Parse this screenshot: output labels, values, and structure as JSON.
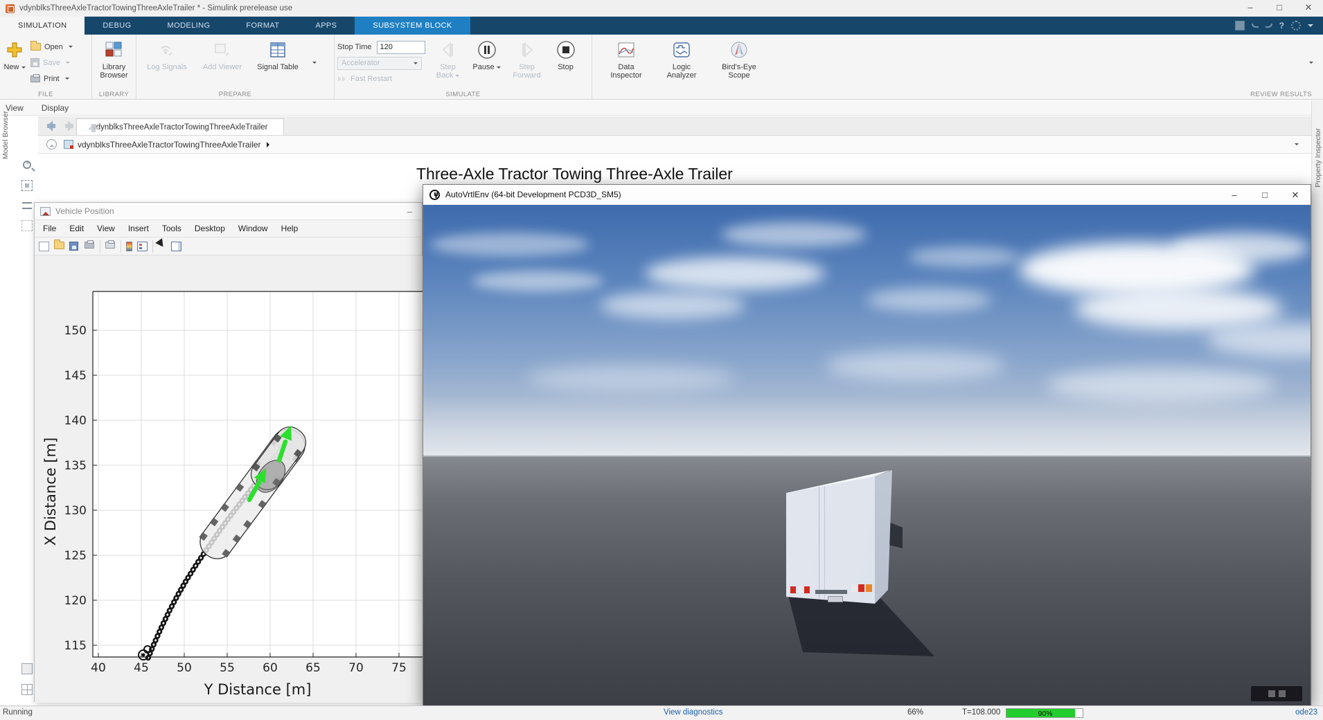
{
  "window": {
    "title": "vdynblksThreeAxleTractorTowingThreeAxleTrailer * - Simulink prerelease use"
  },
  "ribbon_tabs": [
    {
      "label": "SIMULATION",
      "state": "active"
    },
    {
      "label": "DEBUG",
      "state": "normal"
    },
    {
      "label": "MODELING",
      "state": "normal"
    },
    {
      "label": "FORMAT",
      "state": "normal"
    },
    {
      "label": "APPS",
      "state": "normal"
    },
    {
      "label": "SUBSYSTEM BLOCK",
      "state": "context"
    }
  ],
  "ribbon": {
    "sections": [
      "FILE",
      "LIBRARY",
      "PREPARE",
      "SIMULATE",
      "REVIEW RESULTS"
    ],
    "file": {
      "new": "New",
      "open": "Open",
      "save": "Save",
      "print": "Print"
    },
    "library": {
      "browser": "Library Browser"
    },
    "prepare": {
      "log_signals": "Log Signals",
      "add_viewer": "Add Viewer",
      "signal_table": "Signal Table"
    },
    "simulate": {
      "stop_time_label": "Stop Time",
      "stop_time_value": "120",
      "accelerator": "Accelerator",
      "fast_restart": "Fast Restart",
      "step_back": "Step Back",
      "pause": "Pause",
      "step_forward": "Step Forward",
      "stop": "Stop"
    },
    "review": {
      "data_inspector": "Data Inspector",
      "logic_analyzer": "Logic Analyzer",
      "birds_eye": "Bird's-Eye Scope"
    }
  },
  "menubar": {
    "items": [
      "View",
      "Display"
    ]
  },
  "nav": {
    "doc_tab": "vdynblksThreeAxleTractorTowingThreeAxleTrailer",
    "breadcrumb": "vdynblksThreeAxleTractorTowingThreeAxleTrailer"
  },
  "canvas": {
    "title": "Three-Axle Tractor Towing Three-Axle Trailer"
  },
  "left_rail": {
    "label": "Model Browser"
  },
  "right_rail": {
    "label": "Property Inspector"
  },
  "figure": {
    "title": "Vehicle Position",
    "menus": [
      "File",
      "Edit",
      "View",
      "Insert",
      "Tools",
      "Desktop",
      "Window",
      "Help"
    ]
  },
  "vrtl": {
    "title": "AutoVrtlEnv (64-bit Development PCD3D_SM5)"
  },
  "status_bar": {
    "running": "Running",
    "diagnostics": "View diagnostics",
    "zoom": "66%",
    "time": "T=108.000",
    "progress": "90%",
    "progress_fraction": 0.9,
    "solver": "ode23"
  },
  "colors": {
    "ribbon_bar": "#17466b",
    "context_tab": "#1e7fc2",
    "link_blue": "#1b5faa",
    "progress_green": "#23cd2d",
    "arrow_green": "#2ddf2d",
    "trail_black": "#141414"
  },
  "chart_data": {
    "type": "scatter",
    "title": "",
    "xlabel": "Y Distance [m]",
    "ylabel": "X Distance [m]",
    "x_ticks": [
      40,
      45,
      50,
      55,
      60,
      65,
      70,
      75
    ],
    "y_ticks": [
      115,
      120,
      125,
      130,
      135,
      140,
      145,
      150
    ],
    "xlim": [
      38.5,
      78
    ],
    "ylim": [
      112.5,
      154.5
    ],
    "grid": true,
    "legend": null,
    "trajectory": [
      [
        45.8,
        113.6
      ],
      [
        46.5,
        115.2
      ],
      [
        47.3,
        116.9
      ],
      [
        48.2,
        118.7
      ],
      [
        49.2,
        120.5
      ],
      [
        50.3,
        122.3
      ],
      [
        51.5,
        124.1
      ],
      [
        52.8,
        125.9
      ],
      [
        54.1,
        127.7
      ],
      [
        55.4,
        129.4
      ],
      [
        56.7,
        131.0
      ],
      [
        58.0,
        132.6
      ],
      [
        59.2,
        134.2
      ],
      [
        60.3,
        135.7
      ],
      [
        61.0,
        136.5
      ],
      [
        61.4,
        137.2
      ]
    ],
    "vehicle_markers": [
      [
        59.0,
        132.3
      ],
      [
        61.5,
        137.5
      ]
    ],
    "marker_color": "#2ddf2d",
    "trail_color": "#141414"
  }
}
